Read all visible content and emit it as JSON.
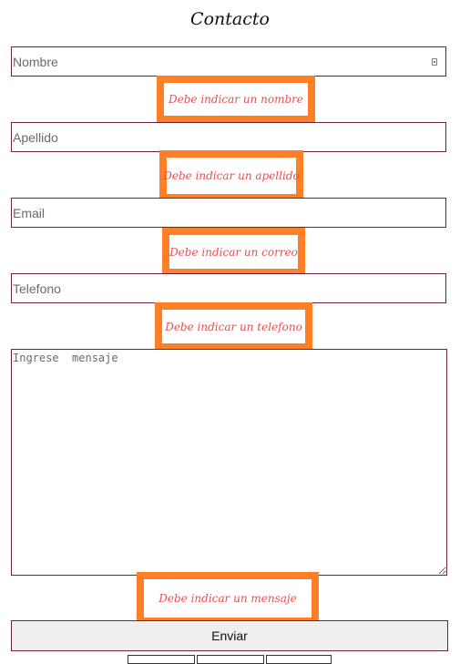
{
  "form": {
    "title": "Contacto",
    "nombre": {
      "placeholder": "Nombre",
      "value": "",
      "error": "Debe indicar un nombre"
    },
    "apellido": {
      "placeholder": "Apellido",
      "value": "",
      "error": "Debe indicar un apellido"
    },
    "email": {
      "placeholder": "Email",
      "value": "",
      "error": "Debe indicar un correo"
    },
    "telefono": {
      "placeholder": "Telefono",
      "value": "",
      "error": "Debe indicar un telefono"
    },
    "mensaje": {
      "placeholder": "Ingrese  mensaje",
      "value": "",
      "error": "Debe indicar un mensaje"
    },
    "submit_label": "Enviar"
  },
  "colors": {
    "field_border": "#6b2440",
    "error_box_border": "#ff7f27",
    "error_text": "#e6504e",
    "button_bg": "#efefef"
  }
}
